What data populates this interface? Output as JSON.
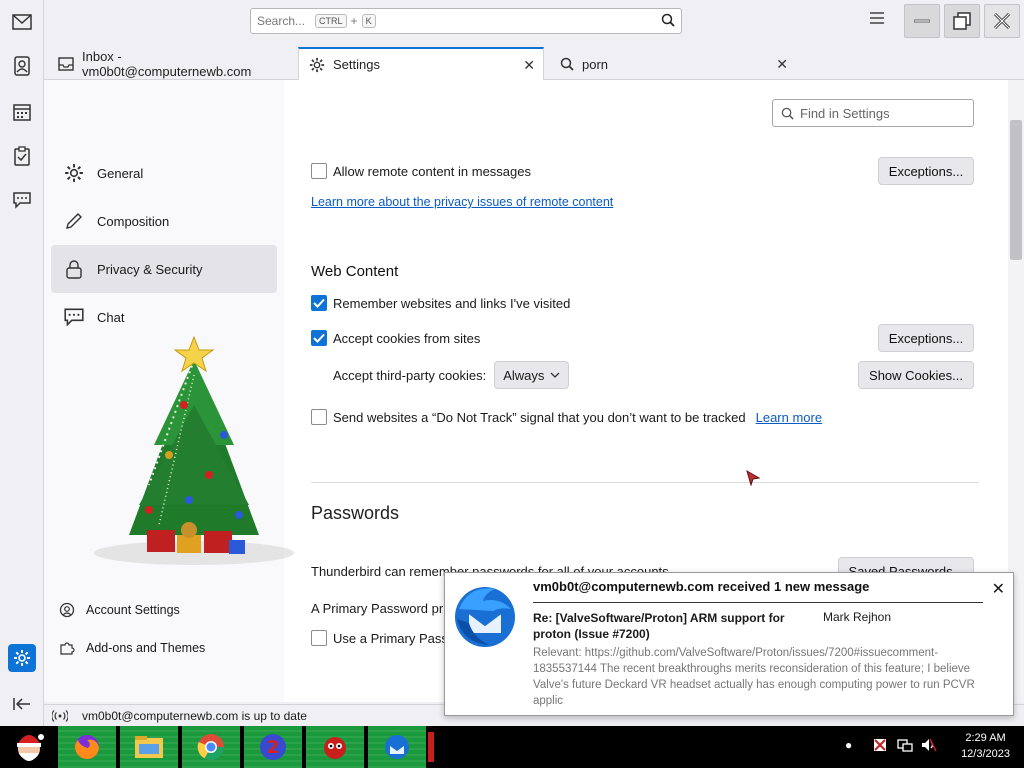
{
  "titlebar": {
    "search_placeholder": "Search...",
    "shortcut_ctrl": "CTRL",
    "shortcut_plus": "+",
    "shortcut_k": "K"
  },
  "tabs": [
    {
      "label": "Inbox - vm0b0t@computernewb.com",
      "icon": "inbox-icon"
    },
    {
      "label": "Settings",
      "icon": "gear-icon"
    },
    {
      "label": "porn",
      "icon": "search-icon"
    }
  ],
  "settings_nav": {
    "items": [
      {
        "label": "General",
        "icon": "gear-icon"
      },
      {
        "label": "Composition",
        "icon": "pencil-icon"
      },
      {
        "label": "Privacy & Security",
        "icon": "lock-icon"
      },
      {
        "label": "Chat",
        "icon": "chat-icon"
      }
    ],
    "footer": [
      {
        "label": "Account Settings",
        "icon": "account-icon"
      },
      {
        "label": "Add-ons and Themes",
        "icon": "puzzle-icon"
      }
    ]
  },
  "main": {
    "find_placeholder": "Find in Settings",
    "allow_remote": {
      "label": "Allow remote content in messages",
      "checked": false
    },
    "exceptions_label": "Exceptions...",
    "remote_link": "Learn more about the privacy issues of remote content",
    "web_content_heading": "Web Content",
    "remember_sites": {
      "label": "Remember websites and links I've visited",
      "checked": true
    },
    "accept_cookies": {
      "label": "Accept cookies from sites",
      "checked": true
    },
    "third_party_label": "Accept third-party cookies:",
    "third_party_value": "Always",
    "show_cookies_label": "Show Cookies...",
    "dnt": {
      "label": "Send websites a “Do Not Track” signal that you don’t want to be tracked",
      "checked": false
    },
    "learn_more": "Learn more",
    "passwords_heading": "Passwords",
    "passwords_text": "Thunderbird can remember passwords for all of your accounts.",
    "saved_passwords_label": "Saved Passwords...",
    "primary_password_text": "A Primary Password pr",
    "use_primary_label": "Use a Primary Pass"
  },
  "statusbar": {
    "text": "vm0b0t@computernewb.com is up to date"
  },
  "notification": {
    "title": "vm0b0t@computernewb.com received 1 new message",
    "subject": "Re: [ValveSoftware/Proton] ARM support for proton (Issue #7200)",
    "from": "Mark Rejhon",
    "body": "Relevant: https://github.com/ValveSoftware/Proton/issues/7200#issuecomment-1835537144 The recent breakthroughs merits reconsideration of this feature; I believe Valve's future Deckard VR headset actually has enough computing power to run PCVR applic"
  },
  "taskbar": {
    "time": "2:29 AM",
    "date": "12/3/2023"
  },
  "colors": {
    "accent": "#0e73d6",
    "link": "#0a5bc4",
    "taskbar_green": "#1a9a3c"
  }
}
